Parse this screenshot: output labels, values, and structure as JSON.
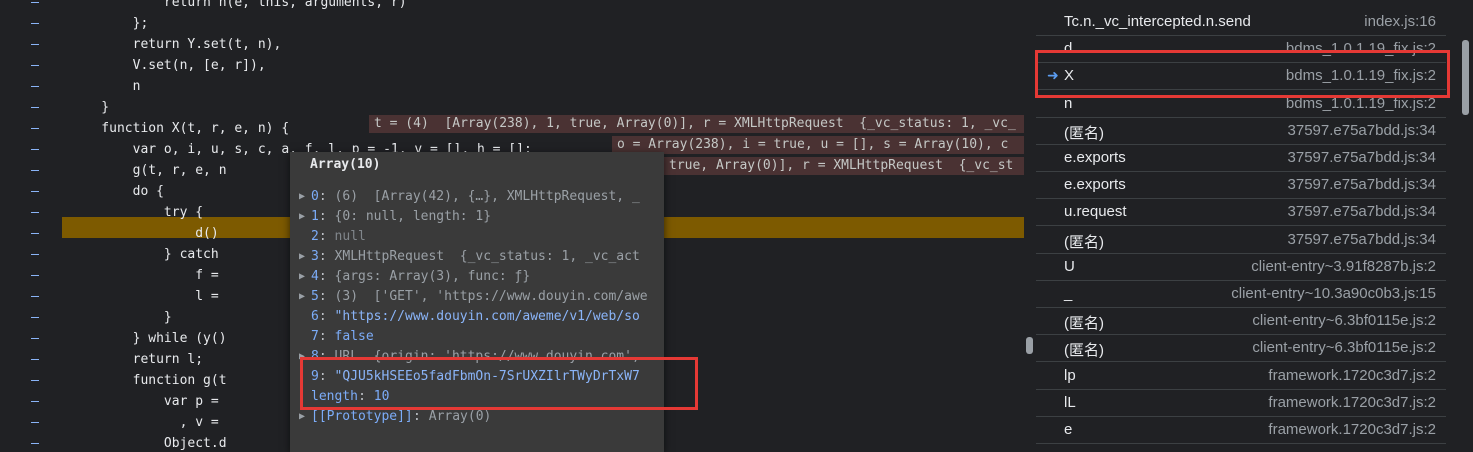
{
  "editor": {
    "lines": [
      {
        "text": "            return n(e, this, arguments, r)"
      },
      {
        "text": "        };"
      },
      {
        "text": "        return Y.set(t, n),"
      },
      {
        "text": "        V.set(n, [e, r]),"
      },
      {
        "text": "        n"
      },
      {
        "text": "    }"
      },
      {
        "text": "    function X(t, r, e, n) {"
      },
      {
        "text": "        var o, i, u, s, c, a, f, l, p = -1, v = [], h = [];"
      },
      {
        "text": "        g(t, r, e, n"
      },
      {
        "text": "        do {"
      },
      {
        "text": "            try {"
      },
      {
        "text": "                d()"
      },
      {
        "text": "            } catch"
      },
      {
        "text": "                f ="
      },
      {
        "text": "                l ="
      },
      {
        "text": "            }"
      },
      {
        "text": "        } while (y()"
      },
      {
        "text": "        return l;"
      },
      {
        "text": "        function g(t"
      },
      {
        "text": "            var p ="
      },
      {
        "text": "              , v ="
      },
      {
        "text": "            Object.d"
      }
    ],
    "inline_values": [
      "t = (4)  [Array(238), 1, true, Array(0)], r = XMLHttpRequest  {_vc_status: 1, _vc_",
      "o = Array(238), i = true, u = [], s = Array(10), c",
      "true, Array(0)], r = XMLHttpRequest  {_vc_st"
    ]
  },
  "popover": {
    "title": "Array(10)",
    "rows": [
      {
        "key": "0",
        "value": "(6)  [Array(42), {…}, XMLHttpRequest, _",
        "expand": true
      },
      {
        "key": "1",
        "value": "{0: null, length: 1}",
        "expand": true
      },
      {
        "key": "2",
        "value": "null",
        "expand": false
      },
      {
        "key": "3",
        "value": "XMLHttpRequest  {_vc_status: 1, _vc_act",
        "expand": true
      },
      {
        "key": "4",
        "value": "{args: Array(3), func: ƒ}",
        "expand": true
      },
      {
        "key": "5",
        "value": "(3)  ['GET', 'https://www.douyin.com/awe",
        "expand": true
      },
      {
        "key": "6",
        "value": "\"https://www.douyin.com/aweme/v1/web/so",
        "expand": false
      },
      {
        "key": "7",
        "value": "false",
        "expand": false
      },
      {
        "key": "8",
        "value": "URL  {origin: 'https://www.douyin.com',",
        "expand": true
      },
      {
        "key": "9",
        "value": "\"QJU5kHSEEo5fadFbmOn-7SrUXZIlrTWyDrTxW7",
        "expand": false
      },
      {
        "key": "length",
        "value": "10",
        "expand": false
      },
      {
        "key": "[[Prototype]]",
        "value": "Array(0)",
        "expand": true
      }
    ]
  },
  "call_stack": {
    "frames": [
      {
        "name": "Tc.n._vc_intercepted.n.send",
        "file": "index.js:16",
        "current": false
      },
      {
        "name": "d",
        "file": "bdms_1.0.1.19_fix.js:2",
        "current": false
      },
      {
        "name": "X",
        "file": "bdms_1.0.1.19_fix.js:2",
        "current": true
      },
      {
        "name": "n",
        "file": "bdms_1.0.1.19_fix.js:2",
        "current": false
      },
      {
        "name": "(匿名)",
        "file": "37597.e75a7bdd.js:34",
        "current": false
      },
      {
        "name": "e.exports",
        "file": "37597.e75a7bdd.js:34",
        "current": false
      },
      {
        "name": "e.exports",
        "file": "37597.e75a7bdd.js:34",
        "current": false
      },
      {
        "name": "u.request",
        "file": "37597.e75a7bdd.js:34",
        "current": false
      },
      {
        "name": "(匿名)",
        "file": "37597.e75a7bdd.js:34",
        "current": false
      },
      {
        "name": "U",
        "file": "client-entry~3.91f8287b.js:2",
        "current": false
      },
      {
        "name": "_",
        "file": "client-entry~10.3a90c0b3.js:15",
        "current": false
      },
      {
        "name": "(匿名)",
        "file": "client-entry~6.3bf0115e.js:2",
        "current": false
      },
      {
        "name": "(匿名)",
        "file": "client-entry~6.3bf0115e.js:2",
        "current": false
      },
      {
        "name": "lp",
        "file": "framework.1720c3d7.js:2",
        "current": false
      },
      {
        "name": "lL",
        "file": "framework.1720c3d7.js:2",
        "current": false
      },
      {
        "name": "e",
        "file": "framework.1720c3d7.js:2",
        "current": false
      }
    ]
  },
  "colors": {
    "accent": "#8ab4f8",
    "highlight": "#7d5a00",
    "annotation_red": "#e53935"
  }
}
